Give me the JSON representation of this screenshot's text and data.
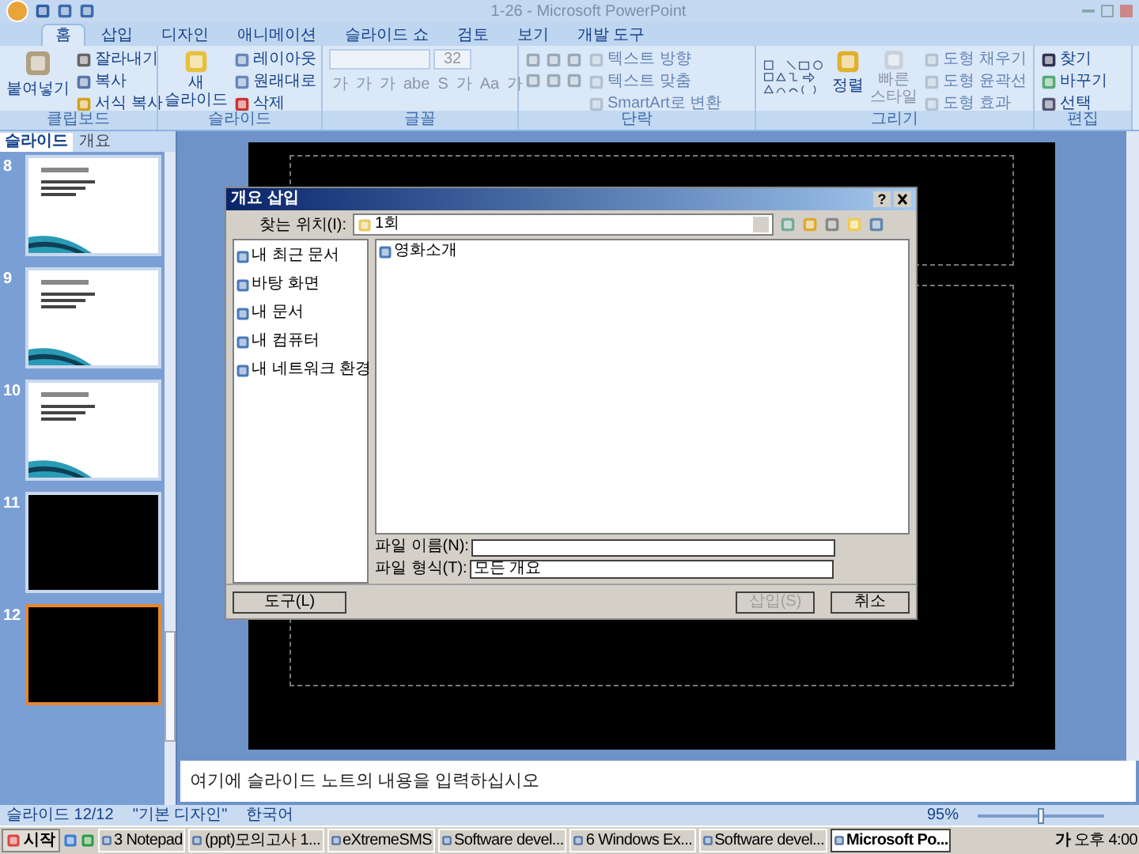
{
  "window": {
    "title": "1-26 - Microsoft PowerPoint"
  },
  "ribbon_tabs": [
    {
      "label": "홈",
      "selected": true
    },
    {
      "label": "삽입",
      "selected": false
    },
    {
      "label": "디자인",
      "selected": false
    },
    {
      "label": "애니메이션",
      "selected": false
    },
    {
      "label": "슬라이드 쇼",
      "selected": false
    },
    {
      "label": "검토",
      "selected": false
    },
    {
      "label": "보기",
      "selected": false
    },
    {
      "label": "개발 도구",
      "selected": false
    }
  ],
  "clipboard": {
    "label": "클립보드",
    "paste": "붙여넣기",
    "cut": "잘라내기",
    "copy": "복사",
    "format_painter": "서식 복사"
  },
  "slides_group": {
    "label": "슬라이드",
    "new_slide": "새\n슬라이드",
    "layout": "레이아웃",
    "reset": "원래대로",
    "delete": "삭제"
  },
  "font": {
    "label": "글꼴",
    "size": "32",
    "buttons": [
      "가",
      "가",
      "가",
      "abe",
      "S",
      "가",
      "Aa",
      "가"
    ]
  },
  "paragraph": {
    "label": "단락",
    "text_direction": "텍스트 방향",
    "align_text": "텍스트 맞춤",
    "smartart": "SmartArt로 변환"
  },
  "drawing": {
    "label": "그리기",
    "arrange": "정렬",
    "quick_styles": "빠른\n스타일",
    "fill": "도형 채우기",
    "outline": "도형 윤곽선",
    "effects": "도형 효과"
  },
  "editing": {
    "label": "편집",
    "find": "찾기",
    "replace": "바꾸기",
    "select": "선택"
  },
  "pane_tabs": [
    {
      "label": "슬라이드",
      "selected": true
    },
    {
      "label": "개요",
      "selected": false
    }
  ],
  "slides": [
    {
      "number": "8",
      "kind": "content",
      "selected": false
    },
    {
      "number": "9",
      "kind": "content",
      "selected": false
    },
    {
      "number": "10",
      "kind": "content",
      "selected": false
    },
    {
      "number": "11",
      "kind": "blank",
      "selected": false
    },
    {
      "number": "12",
      "kind": "blank",
      "selected": true
    }
  ],
  "dialog": {
    "title": "개요 삽입",
    "help": "?",
    "look_in_label": "찾는 위치(I):",
    "look_in": "1회",
    "places": [
      "내 최근 문서",
      "바탕 화면",
      "내 문서",
      "내 컴퓨터",
      "내 네트워크 환경"
    ],
    "files": [
      "영화소개"
    ],
    "file_name_label": "파일 이름(N):",
    "file_type_label": "파일 형식(T):",
    "file_type": "모든 개요",
    "buttons": [
      {
        "label": "도구(L)",
        "kind": "menu",
        "disabled": false
      },
      {
        "label": "삽입(S)",
        "kind": "push",
        "disabled": true
      },
      {
        "label": "취소",
        "kind": "push",
        "disabled": false
      }
    ]
  },
  "notes": {
    "placeholder": "여기에 슬라이드 노트의 내용을 입력하십시오"
  },
  "status_bar": {
    "slide": "슬라이드 12/12",
    "theme": "\"기본 디자인\"",
    "language": "한국어",
    "zoom": "95%",
    "zoom_slider": {
      "level": 0.5
    }
  },
  "taskbar": {
    "start": "시작",
    "tasks": [
      {
        "label": "3 Notepad",
        "selected": false
      },
      {
        "label": "(ppt)모의고사 1...",
        "selected": false
      },
      {
        "label": "eXtremeSMS",
        "selected": false
      },
      {
        "label": "Software devel...",
        "selected": false
      },
      {
        "label": "6 Windows Ex...",
        "selected": false
      },
      {
        "label": "Software devel...",
        "selected": false
      },
      {
        "label": "Microsoft Po...",
        "selected": true
      }
    ],
    "ime": "가",
    "clock": "오후 4:00"
  }
}
